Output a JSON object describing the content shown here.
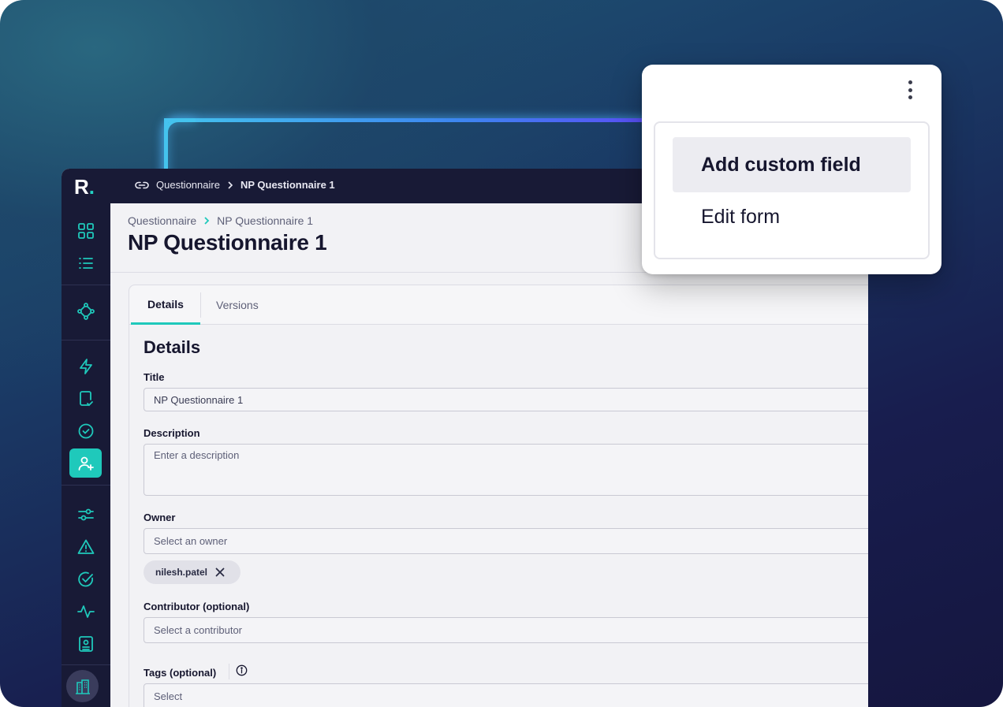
{
  "app": {
    "logo_letter": "R",
    "logo_dot": "."
  },
  "topbar": {
    "breadcrumb": [
      "Questionnaire",
      "NP Questionnaire 1"
    ]
  },
  "page": {
    "breadcrumb": [
      "Questionnaire",
      "NP Questionnaire 1"
    ],
    "title": "NP Questionnaire 1"
  },
  "tabs": [
    {
      "label": "Details",
      "active": true
    },
    {
      "label": "Versions",
      "active": false
    }
  ],
  "form": {
    "section_title": "Details",
    "title_label": "Title",
    "title_value": "NP Questionnaire 1",
    "description_label": "Description",
    "description_placeholder": "Enter a description",
    "owner_label": "Owner",
    "owner_placeholder": "Select an owner",
    "owner_chip": "nilesh.patel",
    "contributor_label": "Contributor (optional)",
    "contributor_placeholder": "Select a contributor",
    "tags_label": "Tags (optional)",
    "tags_placeholder": "Select"
  },
  "popover": {
    "menu_items": [
      "Add custom field",
      "Edit form"
    ]
  },
  "sidebar_icons": [
    "grid-icon",
    "list-icon",
    "network-icon",
    "lightning-icon",
    "document-check-icon",
    "badge-check-icon",
    "user-add-icon",
    "sliders-icon",
    "warning-icon",
    "check-circle-icon",
    "activity-icon",
    "report-icon",
    "building-icon"
  ],
  "colors": {
    "accent": "#1fc9bb",
    "sidebar_bg": "#181a36",
    "title_text": "#16162e"
  }
}
